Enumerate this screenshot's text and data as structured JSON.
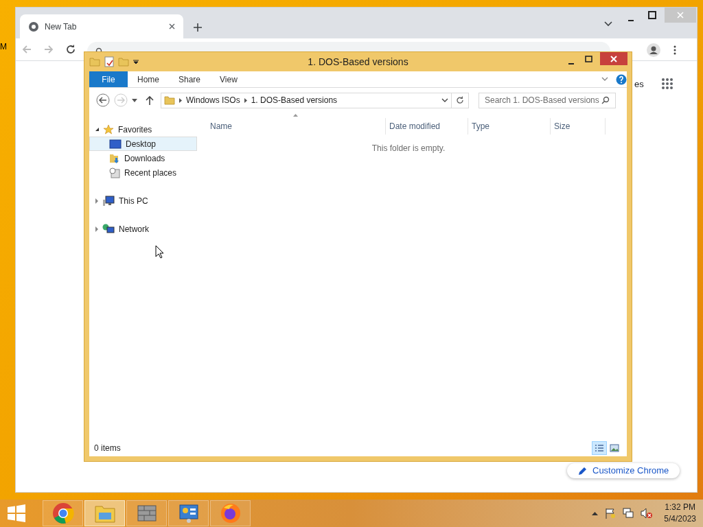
{
  "desktop": {
    "icon_label": "M"
  },
  "chrome": {
    "tab": {
      "title": "New Tab"
    },
    "page": {
      "link_fragment": "es",
      "customize_button": "Customize Chrome"
    }
  },
  "explorer": {
    "title": "1. DOS-Based versions",
    "ribbon_tabs": [
      {
        "label": "File",
        "kind": "menu"
      },
      {
        "label": "Home",
        "kind": "tab"
      },
      {
        "label": "Share",
        "kind": "tab"
      },
      {
        "label": "View",
        "kind": "tab"
      }
    ],
    "breadcrumb": [
      "Windows ISOs",
      "1. DOS-Based versions"
    ],
    "search": {
      "placeholder": "Search 1. DOS-Based versions"
    },
    "nav": [
      {
        "label": "Favorites",
        "kind": "favorites",
        "expanded": true,
        "selected": false,
        "children": [
          {
            "label": "Desktop",
            "kind": "desktop",
            "selected": true
          },
          {
            "label": "Downloads",
            "kind": "downloads",
            "selected": false
          },
          {
            "label": "Recent places",
            "kind": "recent",
            "selected": false
          }
        ]
      },
      {
        "label": "This PC",
        "kind": "pc",
        "expanded": false,
        "selected": false
      },
      {
        "label": "Network",
        "kind": "network",
        "expanded": false,
        "selected": false
      }
    ],
    "columns": [
      "Name",
      "Date modified",
      "Type",
      "Size"
    ],
    "empty_message": "This folder is empty.",
    "status": "0 items",
    "views": [
      {
        "kind": "details",
        "selected": true
      },
      {
        "kind": "large-icons",
        "selected": false
      }
    ]
  },
  "taskbar": {
    "apps": [
      {
        "kind": "chrome",
        "active": false
      },
      {
        "kind": "explorer",
        "active": true
      },
      {
        "kind": "firewall",
        "active": false
      },
      {
        "kind": "control-panel",
        "active": false
      },
      {
        "kind": "firefox",
        "active": false
      }
    ],
    "clock": {
      "time": "1:32 PM",
      "date": "5/4/2023"
    }
  }
}
